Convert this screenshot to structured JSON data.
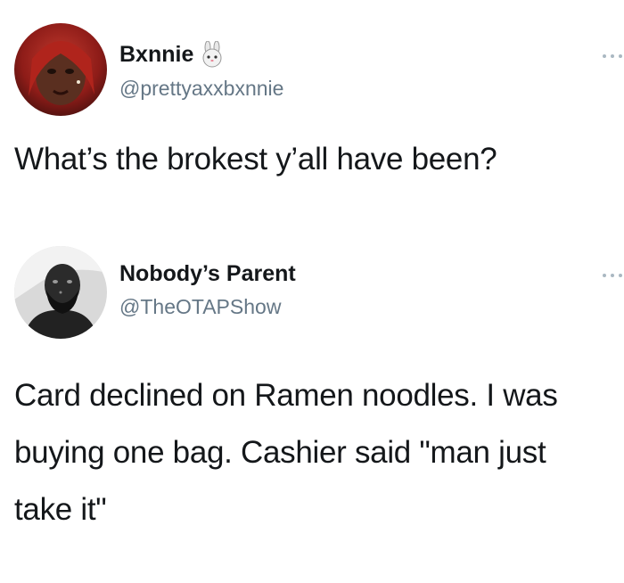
{
  "tweets": [
    {
      "display_name": "Bxnnie",
      "handle": "@prettyaxxbxnnie",
      "name_emoji": "bunny-emoji",
      "text": "What’s the brokest y’all have been?",
      "more_icon": "more-dots-icon"
    },
    {
      "display_name": "Nobody’s Parent",
      "handle": "@TheOTAPShow",
      "text": "Card declined on Ramen noodles. I was buying one bag. Cashier said \"man just take it\"",
      "more_icon": "more-dots-icon"
    }
  ],
  "colors": {
    "text": "#14171a",
    "handle": "#657786",
    "background": "#ffffff"
  }
}
